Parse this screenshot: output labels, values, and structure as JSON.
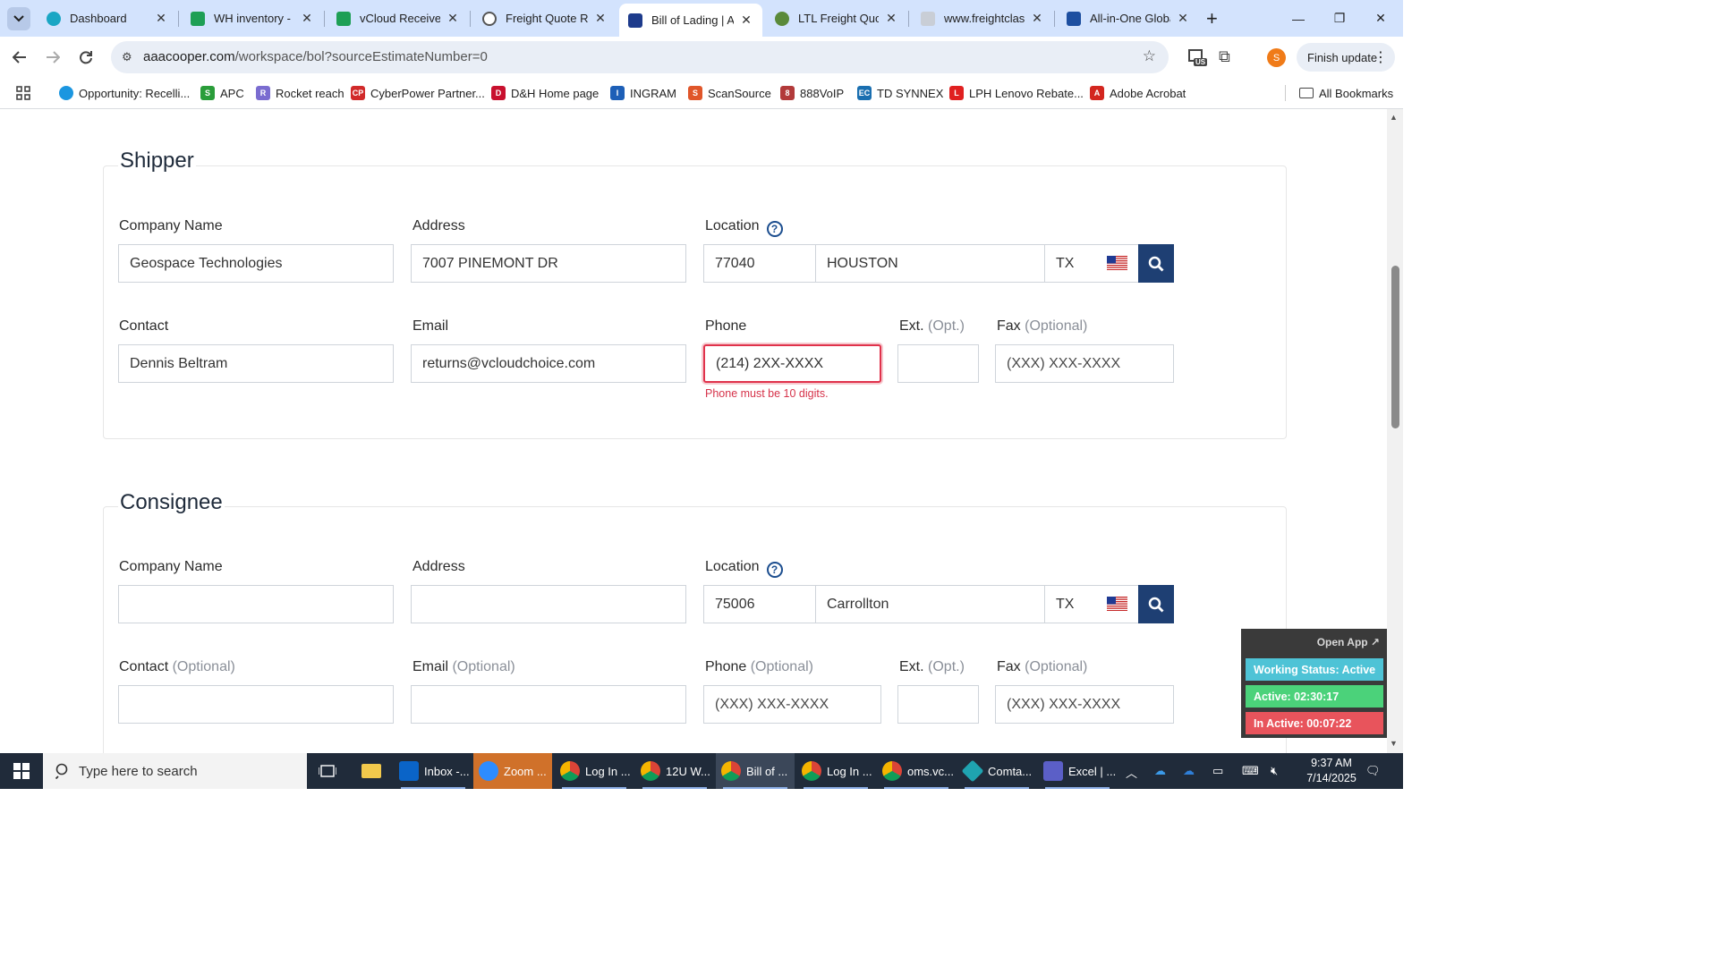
{
  "browser": {
    "tabs": [
      {
        "title": "Dashboard",
        "color": "#1aa6c4"
      },
      {
        "title": "WH inventory - (",
        "color": "#1e9f55"
      },
      {
        "title": "vCloud Receive F",
        "color": "#1e9f55"
      },
      {
        "title": "Freight Quote Re",
        "color": "#555555"
      },
      {
        "title": "Bill of Lading | A",
        "color": "#1d3b8c",
        "active": true
      },
      {
        "title": "LTL Freight Quot",
        "color": "#5a8a3a"
      },
      {
        "title": "www.freightclass",
        "color": "#8a8f98"
      },
      {
        "title": "All-in-One Globa",
        "color": "#1d4fa0"
      }
    ],
    "new_tab": "+",
    "url_host": "aaacooper.com",
    "url_path": "/workspace/bol?sourceEstimateNumber=0",
    "finish_update": "Finish update",
    "profile_initial": "S",
    "ext_badge": "US"
  },
  "bookmarks": [
    {
      "label": "Opportunity: Recelli...",
      "color": "#1b96e0",
      "glyph": ""
    },
    {
      "label": "APC",
      "color": "#2a9d3a",
      "glyph": "S"
    },
    {
      "label": "Rocket reach",
      "color": "#7a6cd0",
      "glyph": "R"
    },
    {
      "label": "CyberPower Partner...",
      "color": "#d12a2a",
      "glyph": "CP"
    },
    {
      "label": "D&H Home page",
      "color": "#c8102e",
      "glyph": "D"
    },
    {
      "label": "INGRAM",
      "color": "#1d5fb7",
      "glyph": "I"
    },
    {
      "label": "ScanSource",
      "color": "#e0562a",
      "glyph": "S"
    },
    {
      "label": "888VoIP",
      "color": "#b23a3a",
      "glyph": "8"
    },
    {
      "label": "TD SYNNEX",
      "color": "#1a6fb0",
      "glyph": "EC"
    },
    {
      "label": "LPH Lenovo Rebate...",
      "color": "#e02020",
      "glyph": "L"
    },
    {
      "label": "Adobe Acrobat",
      "color": "#d3261f",
      "glyph": "A"
    }
  ],
  "all_bookmarks": "All Bookmarks",
  "shipper": {
    "legend": "Shipper",
    "company_label": "Company Name",
    "company_value": "Geospace Technologies",
    "address_label": "Address",
    "address_value": "7007 PINEMONT DR",
    "location_label": "Location",
    "zip": "77040",
    "city": "HOUSTON",
    "state": "TX",
    "contact_label": "Contact",
    "contact_value": "Dennis Beltram",
    "email_label": "Email",
    "email_value": "returns@vcloudchoice.com",
    "phone_label": "Phone",
    "phone_value": "(214) 2XX-XXXX",
    "phone_error": "Phone must be 10 digits.",
    "ext_label": "Ext.",
    "ext_opt": "(Opt.)",
    "fax_label": "Fax",
    "fax_opt": "(Optional)",
    "fax_placeholder": "(XXX) XXX-XXXX"
  },
  "consignee": {
    "legend": "Consignee",
    "company_label": "Company Name",
    "address_label": "Address",
    "location_label": "Location",
    "zip": "75006",
    "city": "Carrollton",
    "state": "TX",
    "contact_label": "Contact",
    "contact_opt": "(Optional)",
    "email_label": "Email",
    "email_opt": "(Optional)",
    "phone_label": "Phone",
    "phone_opt": "(Optional)",
    "phone_placeholder": "(XXX) XXX-XXXX",
    "ext_label": "Ext.",
    "ext_opt": "(Opt.)",
    "fax_label": "Fax",
    "fax_opt": "(Optional)",
    "fax_placeholder": "(XXX) XXX-XXXX"
  },
  "widget": {
    "open_app": "Open App ↗",
    "working_status": "Working Status: Active",
    "active": "Active: 02:30:17",
    "inactive": "In Active: 00:07:22"
  },
  "taskbar": {
    "search_placeholder": "Type here to search",
    "items": [
      {
        "label": "Inbox -...",
        "color": "#0a64c8"
      },
      {
        "label": "Zoom ...",
        "color": "#2d8cff",
        "active": true
      },
      {
        "label": "Log In ...",
        "color": "#e8b818"
      },
      {
        "label": "12U W...",
        "color": "#e8b818"
      },
      {
        "label": "Bill of ...",
        "color": "#e8b818",
        "active": true
      },
      {
        "label": "Log In ...",
        "color": "#e8b818"
      },
      {
        "label": "oms.vc...",
        "color": "#e8b818"
      },
      {
        "label": "Comta...",
        "color": "#1fa3b0"
      },
      {
        "label": "Excel | ...",
        "color": "#5b5fc7"
      }
    ],
    "time": "9:37 AM",
    "date": "7/14/2025"
  },
  "colors": {
    "accent": "#1e3f73",
    "error": "#e0324b",
    "working": "#4ec3d6",
    "active": "#4bd27a",
    "inactive": "#e8545c"
  }
}
